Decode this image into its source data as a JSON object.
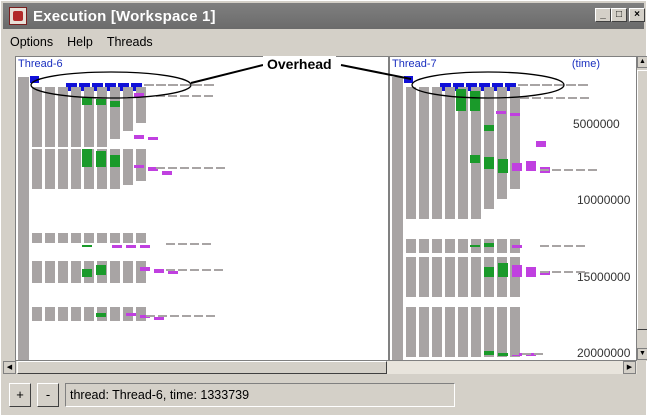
{
  "window": {
    "title": "Execution  [Workspace 1]"
  },
  "title_buttons": {
    "minimize": "_",
    "maximize": "□",
    "close": "×"
  },
  "menu": [
    "Options",
    "Help",
    "Threads"
  ],
  "panels": {
    "left": {
      "thread": "Thread-6"
    },
    "right": {
      "thread": "Thread-7",
      "time_label": "(time)",
      "ticks": [
        "5000000",
        "10000000",
        "15000000",
        "20000000"
      ]
    }
  },
  "annotation": {
    "label": "Overhead"
  },
  "status": {
    "plus": "+",
    "minus": "-",
    "text": "thread: Thread-6, time: 1333739"
  },
  "colors": {
    "overhead": "#1010d8",
    "gray": "#a8a4a4",
    "green": "#1a9a2a",
    "magenta": "#c040e0",
    "label_blue": "#1a2fbf"
  }
}
